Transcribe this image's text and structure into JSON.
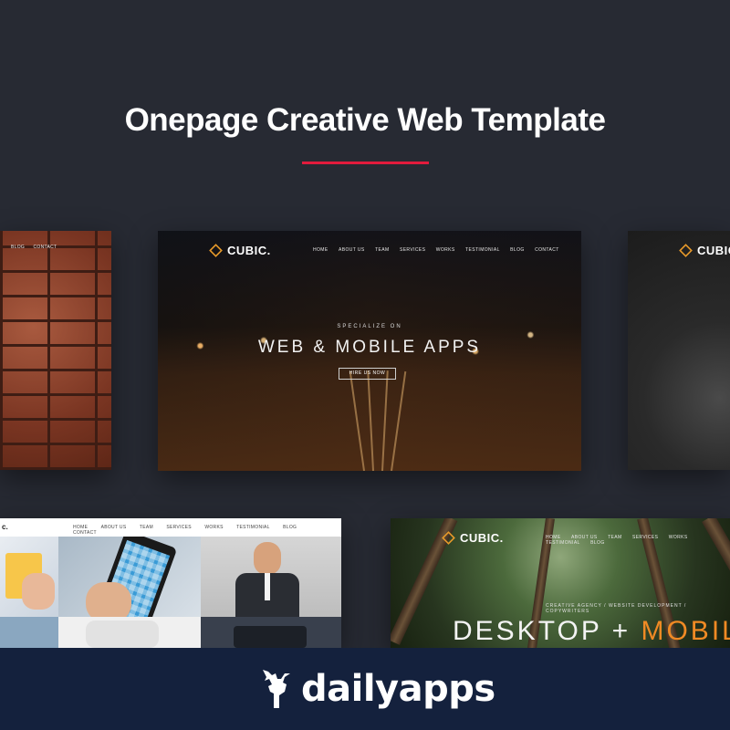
{
  "headline": "Onepage Creative Web Template",
  "colors": {
    "background": "#272a33",
    "accent_rule": "#e21b3c",
    "footer": "#14213d",
    "brand_orange": "#e89a2a"
  },
  "brick_card": {
    "nav": [
      "BLOG",
      "CONTACT"
    ]
  },
  "hero_card": {
    "brand": "CUBIC.",
    "nav": [
      "HOME",
      "ABOUT US",
      "TEAM",
      "SERVICES",
      "WORKS",
      "TESTIMONIAL",
      "BLOG",
      "CONTACT"
    ],
    "kicker": "SPECIALIZE ON",
    "title": "WEB & MOBILE APPS",
    "cta": "HIRE US NOW"
  },
  "right_card": {
    "brand": "CUBIC"
  },
  "grid_card": {
    "logo": "c.",
    "nav": [
      "HOME",
      "ABOUT US",
      "TEAM",
      "SERVICES",
      "WORKS",
      "TESTIMONIAL",
      "BLOG",
      "CONTACT"
    ]
  },
  "forest_card": {
    "brand": "CUBIC.",
    "nav": [
      "HOME",
      "ABOUT US",
      "TEAM",
      "SERVICES",
      "WORKS",
      "TESTIMONIAL",
      "BLOG"
    ],
    "kicker": "CREATIVE AGENCY / WEBSITE DEVELOPMENT / COPYWRITERS",
    "title_main": "DESKTOP + ",
    "title_accent": "MOBIL"
  },
  "footer": {
    "brand": "dailyapps",
    "icon": "deer-icon"
  }
}
